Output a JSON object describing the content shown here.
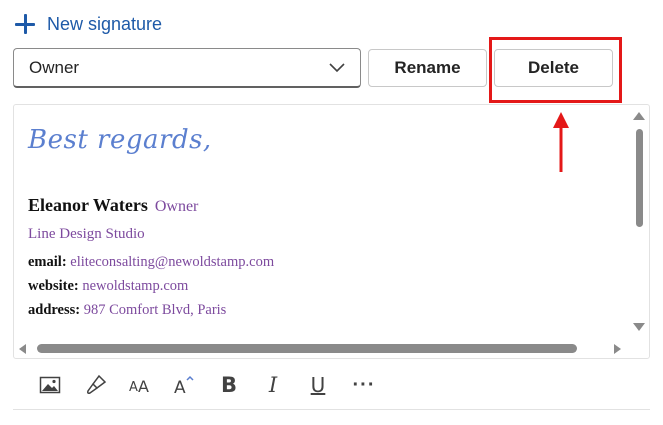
{
  "new_signature": {
    "label": "New signature",
    "icon": "plus-icon",
    "color": "#1e5aa8"
  },
  "signature_select": {
    "value": "Owner",
    "icon": "chevron-down-icon"
  },
  "buttons": {
    "rename": "Rename",
    "delete": "Delete"
  },
  "annotation": {
    "color": "#e41818",
    "target": "delete-button"
  },
  "signature": {
    "greeting": "Best regards,",
    "name": "Eleanor Waters",
    "role": "Owner",
    "company": "Line Design Studio",
    "email_label": "email:",
    "email": "eliteconsalting@newoldstamp.com",
    "website_label": "website:",
    "website": "newoldstamp.com",
    "address_label": "address:",
    "address": "987 Comfort Blvd, Paris",
    "accent_color": "#7d4a9e"
  },
  "toolbar": {
    "items": [
      "image-icon",
      "format-painter-icon",
      "font-size-icon",
      "font-size-increase-icon",
      "bold-icon",
      "italic-icon",
      "underline-icon",
      "more-options-icon"
    ],
    "bold_label": "B",
    "italic_label": "I",
    "underline_label": "U",
    "more_label": "···"
  }
}
